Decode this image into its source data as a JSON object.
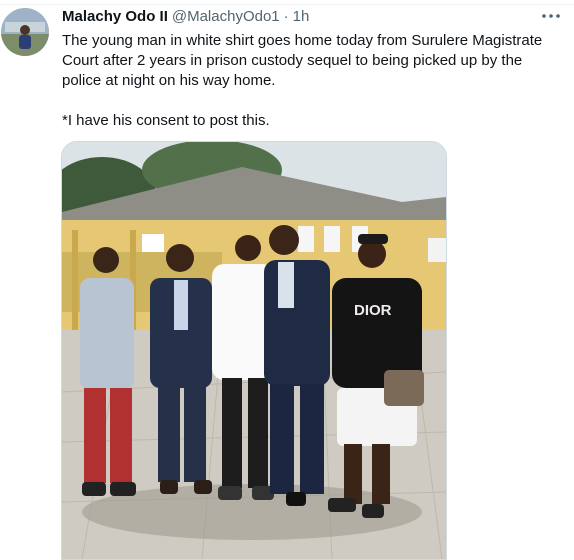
{
  "tweet": {
    "author_name": "Malachy Odo II",
    "author_handle": "@MalachyOdo1",
    "separator": "·",
    "time": "1h",
    "more_icon": "ellipsis-icon",
    "text_line1": "The young man in white shirt goes home today from Surulere Magistrate Court after 2 years in prison custody sequel to being picked up by the police at night on his way home.",
    "text_line2": "*I have his consent to post this.",
    "photo_shirt_text": "DIOR"
  },
  "colors": {
    "text": "#0f1419",
    "secondary": "#536471",
    "border": "#cfd9de"
  }
}
